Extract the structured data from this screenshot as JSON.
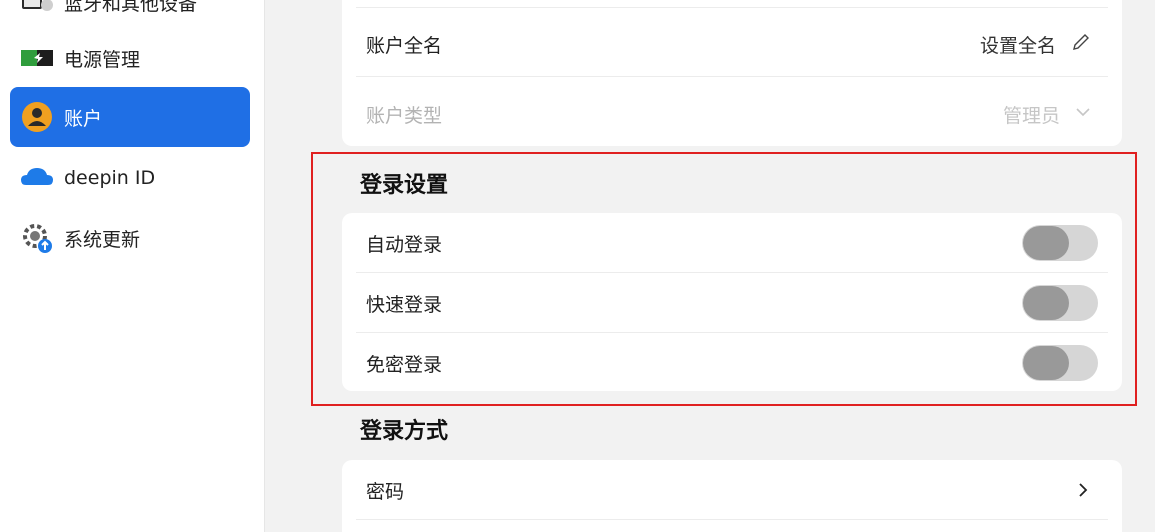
{
  "sidebar": {
    "items": [
      {
        "label": "蓝牙和其他设备",
        "icon": "bluetooth-devices-icon"
      },
      {
        "label": "电源管理",
        "icon": "power-icon"
      },
      {
        "label": "账户",
        "icon": "user-account-icon",
        "active": true
      },
      {
        "label": "deepin ID",
        "icon": "cloud-icon"
      },
      {
        "label": "系统更新",
        "icon": "system-update-icon"
      }
    ]
  },
  "account": {
    "fullname_label": "账户全名",
    "fullname_value": "设置全名",
    "type_label": "账户类型",
    "type_value": "管理员"
  },
  "login_settings": {
    "title": "登录设置",
    "items": [
      {
        "label": "自动登录",
        "enabled": false
      },
      {
        "label": "快速登录",
        "enabled": false
      },
      {
        "label": "免密登录",
        "enabled": false
      }
    ]
  },
  "login_methods": {
    "title": "登录方式",
    "items": [
      {
        "label": "密码"
      }
    ]
  },
  "colors": {
    "accent": "#1f6fe5",
    "highlight": "#e02020"
  }
}
